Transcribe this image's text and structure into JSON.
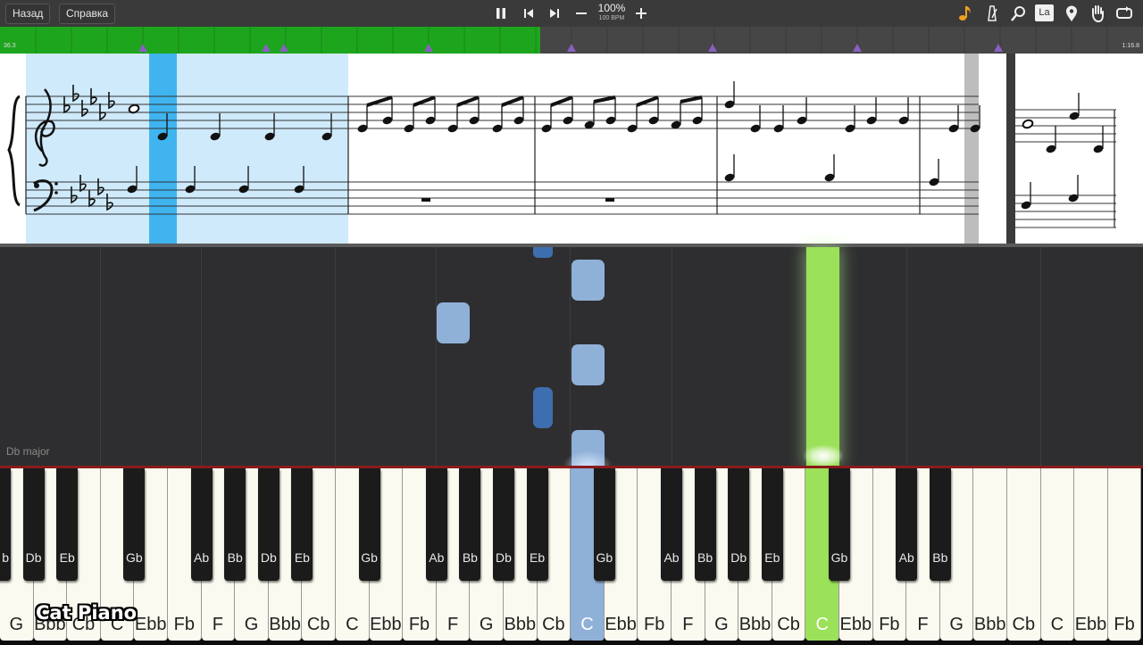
{
  "toolbar": {
    "back_label": "Назад",
    "help_label": "Справка",
    "speed": "100%",
    "bpm": "100 BPM",
    "icons": [
      "pause-icon",
      "prev-icon",
      "next-icon",
      "minus-icon",
      "plus-icon",
      "music-note-icon",
      "metronome-icon",
      "magnifier-icon",
      "note-label-icon",
      "location-pin-icon",
      "hand-icon",
      "loop-icon"
    ],
    "note_label_icon_text": "La"
  },
  "timeline": {
    "start_time": "36.3",
    "end_time": "1:16.8",
    "progress": 0.473,
    "accent_color": "#1ea51e"
  },
  "sheet": {
    "key_signature": "Db major",
    "highlight_color": "#cfeafb",
    "cursor_color": "#3fb4ef"
  },
  "falling_notes": [
    {
      "note": "Bbb",
      "color": "#8fb1d8"
    },
    {
      "note": "Cb",
      "color": "#3d6fb0"
    },
    {
      "note": "C",
      "color": "#8fb1d8"
    },
    {
      "note": "C",
      "color": "#9be15a"
    }
  ],
  "keyboard": {
    "white_keys": [
      "G",
      "Bbb",
      "Cb",
      "C",
      "Ebb",
      "Fb",
      "F",
      "G",
      "Bbb",
      "Cb",
      "C",
      "Ebb",
      "Fb",
      "F",
      "G",
      "Bbb",
      "Cb",
      "C",
      "Ebb",
      "Fb",
      "F",
      "G",
      "Bbb",
      "Cb",
      "C",
      "Ebb",
      "Fb",
      "F",
      "G",
      "Bbb",
      "Cb",
      "C",
      "Ebb",
      "Fb"
    ],
    "black_keys": [
      "Db",
      "Eb",
      "Gb",
      "Ab",
      "Bb",
      "Db",
      "Eb",
      "Gb",
      "Ab",
      "Bb",
      "Db",
      "Eb",
      "Gb",
      "Ab",
      "Bb",
      "Db",
      "Eb",
      "Gb",
      "Ab",
      "Bb"
    ],
    "lead_black_label": "b",
    "pressed": [
      {
        "key": "C",
        "color": "#8fb1d8"
      },
      {
        "key": "C",
        "color": "#9be15a"
      }
    ]
  },
  "watermark": "Cat Piano"
}
